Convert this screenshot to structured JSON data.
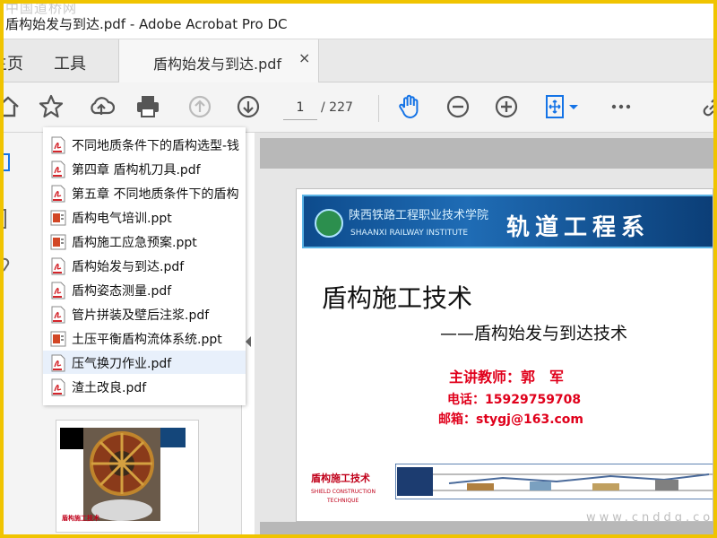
{
  "window": {
    "title": "盾构始发与到达.pdf - Adobe Acrobat Pro DC",
    "watermark_top": "中国道桥网"
  },
  "tabs": {
    "home": "主页",
    "tools": "工具",
    "document": "盾构始发与到达.pdf",
    "close_symbol": "×"
  },
  "toolbar": {
    "current_page": "1",
    "total_pages": "/ 227",
    "icons": [
      "home-icon",
      "star-icon",
      "upload-icon",
      "print-icon",
      "page-up-icon",
      "page-down-icon",
      "hand-icon",
      "zoom-out-icon",
      "zoom-in-icon",
      "fit-page-icon",
      "more-icon",
      "link-icon"
    ]
  },
  "file_popup": {
    "items": [
      {
        "name": "不同地质条件下的盾构选型-钱",
        "type": "pdf"
      },
      {
        "name": "第四章 盾构机刀具.pdf",
        "type": "pdf"
      },
      {
        "name": "第五章 不同地质条件下的盾构",
        "type": "pdf"
      },
      {
        "name": "盾构电气培训.ppt",
        "type": "ppt"
      },
      {
        "name": "盾构施工应急预案.ppt",
        "type": "ppt"
      },
      {
        "name": "盾构始发与到达.pdf",
        "type": "pdf"
      },
      {
        "name": "盾构姿态测量.pdf",
        "type": "pdf"
      },
      {
        "name": "管片拼装及壁后注浆.pdf",
        "type": "pdf"
      },
      {
        "name": "土压平衡盾构流体系统.ppt",
        "type": "ppt"
      },
      {
        "name": "压气换刀作业.pdf",
        "type": "pdf",
        "selected": true
      },
      {
        "name": "渣土改良.pdf",
        "type": "pdf"
      }
    ]
  },
  "thumbnail": {
    "caption": "盾构施工技术"
  },
  "slide": {
    "school_cn": "陕西铁路工程职业技术学院",
    "school_en": "SHAANXI RAILWAY INSTITUTE",
    "department": "轨道工程系",
    "title": "盾构施工技术",
    "subtitle": "——盾构始发与到达技术",
    "lecturer": "主讲教师：郭　军",
    "phone": "电话：15929759708",
    "email": "邮箱：stygj@163.com",
    "footer_title": "盾构施工技术",
    "footer_en1": "SHIELD CONSTRUCTION",
    "footer_en2": "TECHNIQUE"
  },
  "watermark_bottom": "www.cnddq.com",
  "colors": {
    "accent_blue": "#1473e6",
    "slide_red": "#e0001b",
    "frame_yellow": "#f0c400",
    "banner_blue": "#0d4b8c"
  }
}
